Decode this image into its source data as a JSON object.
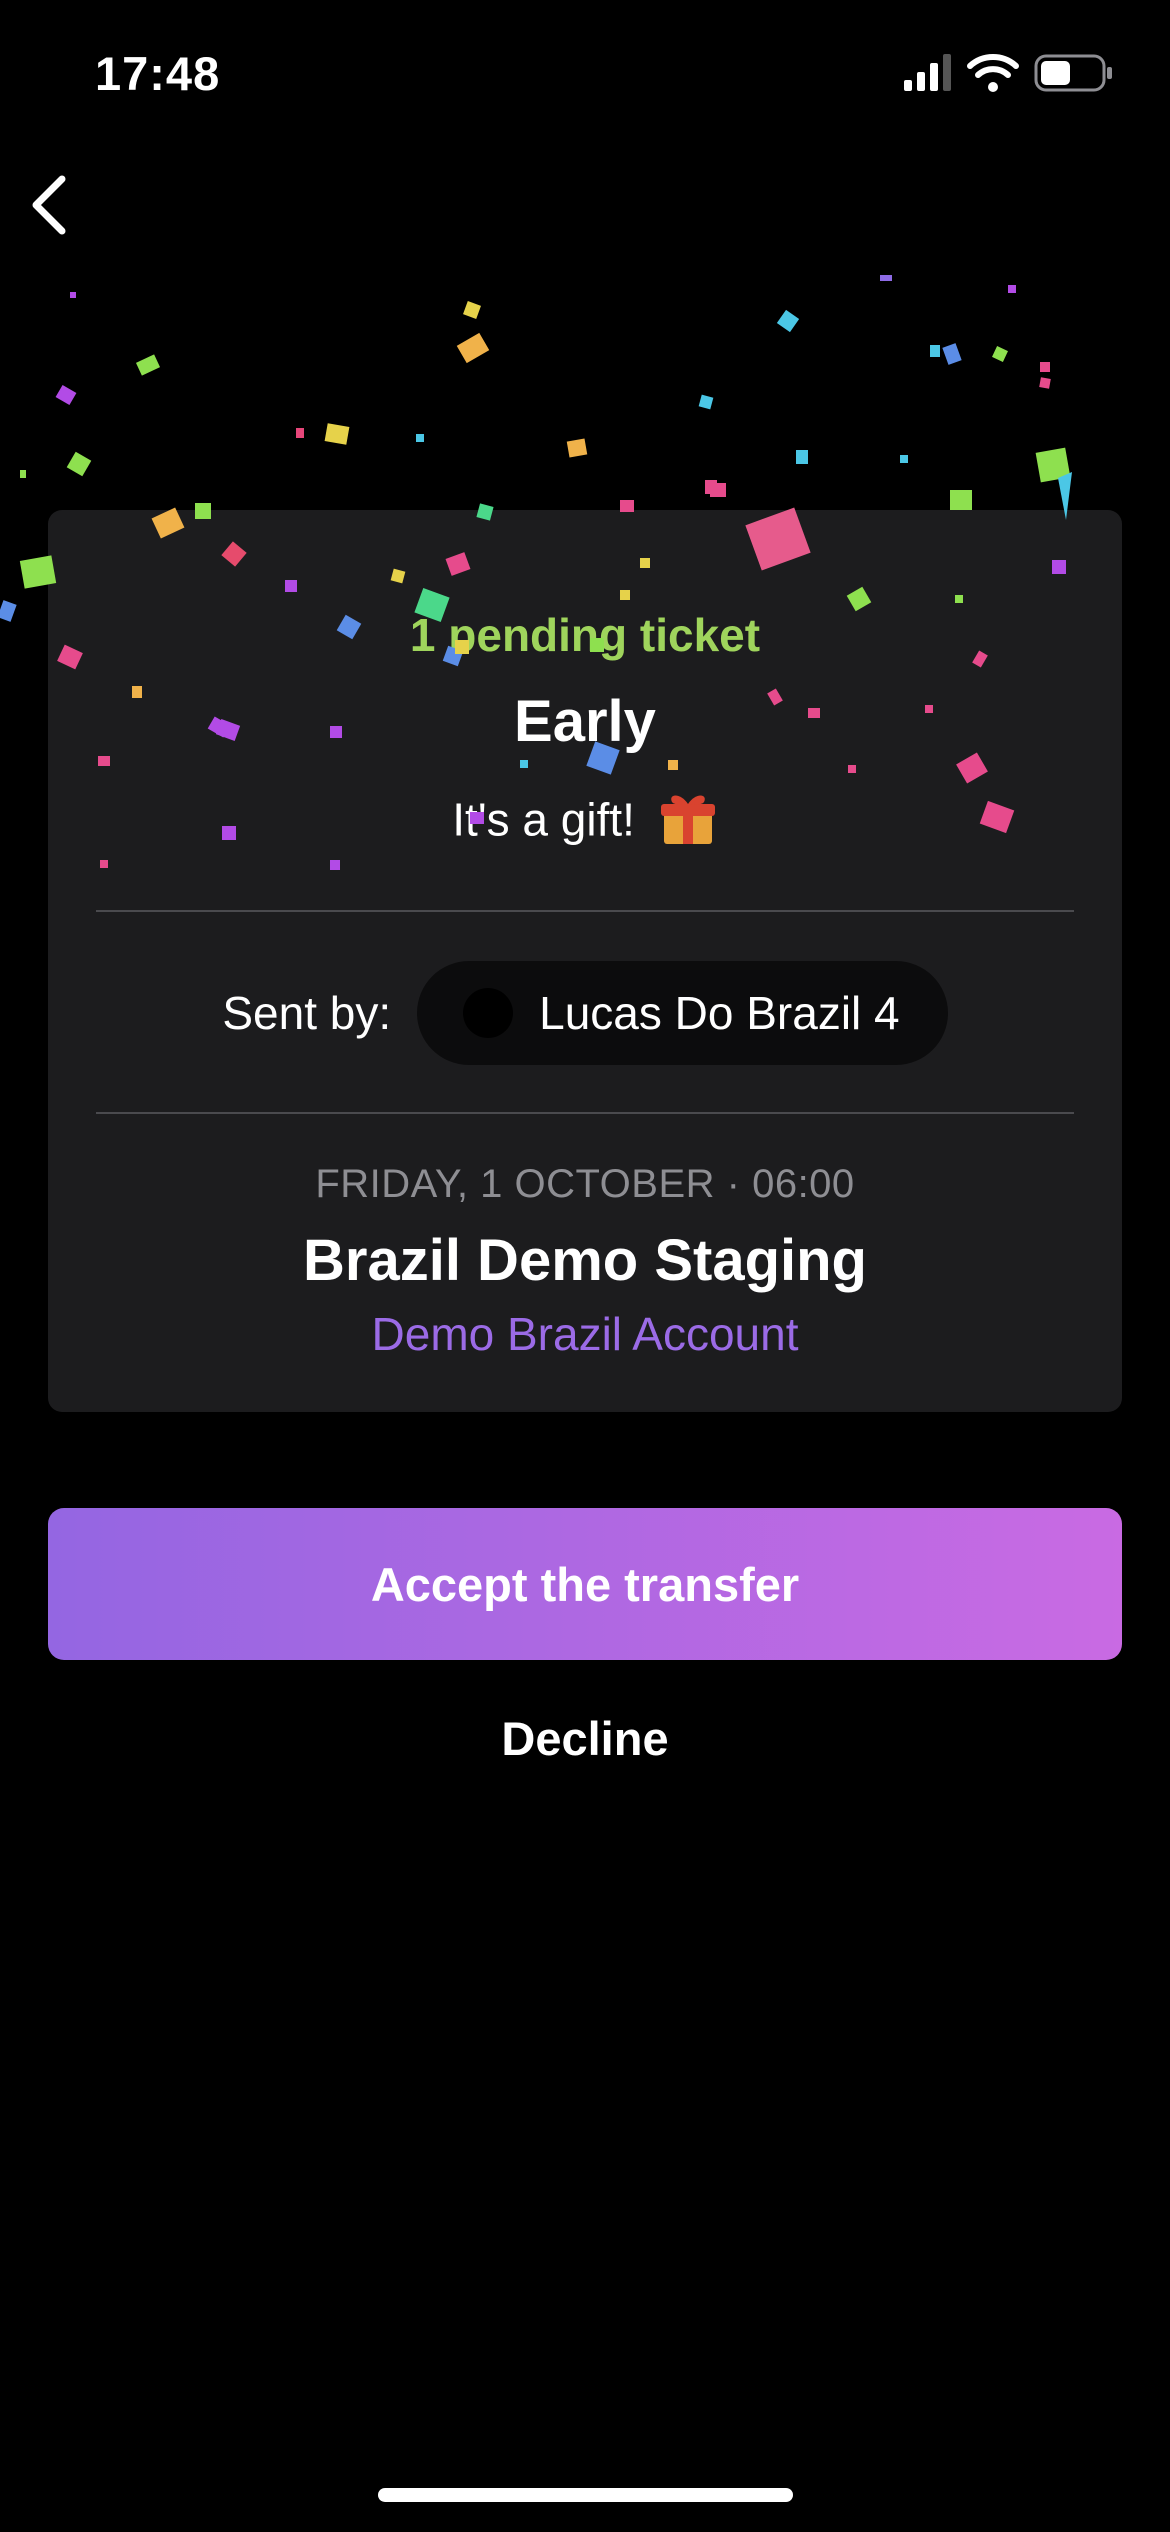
{
  "status_bar": {
    "time": "17:48",
    "icons": [
      "cellular-signal-icon",
      "wifi-icon",
      "battery-icon"
    ]
  },
  "navigation": {
    "back_icon": "chevron-left-icon"
  },
  "transfer_card": {
    "pending_label": "1 pending ticket",
    "ticket_name": "Early",
    "gift_text": "It's a gift!",
    "gift_emoji": "🎁",
    "sent_by_label": "Sent by:",
    "sender_name": "Lucas Do Brazil 4",
    "event_date": "FRIDAY, 1 OCTOBER · 06:00",
    "event_title": "Brazil Demo Staging",
    "organizer": "Demo Brazil Account"
  },
  "actions": {
    "accept_label": "Accept the transfer",
    "decline_label": "Decline"
  },
  "colors": {
    "background": "#000000",
    "card": "#1c1c1e",
    "pending_green": "#9fd45c",
    "organizer_purple": "#9b6be6",
    "accent_gradient_start": "#9466e2",
    "accent_gradient_end": "#c96ae3",
    "date_gray": "#8e8e93"
  }
}
